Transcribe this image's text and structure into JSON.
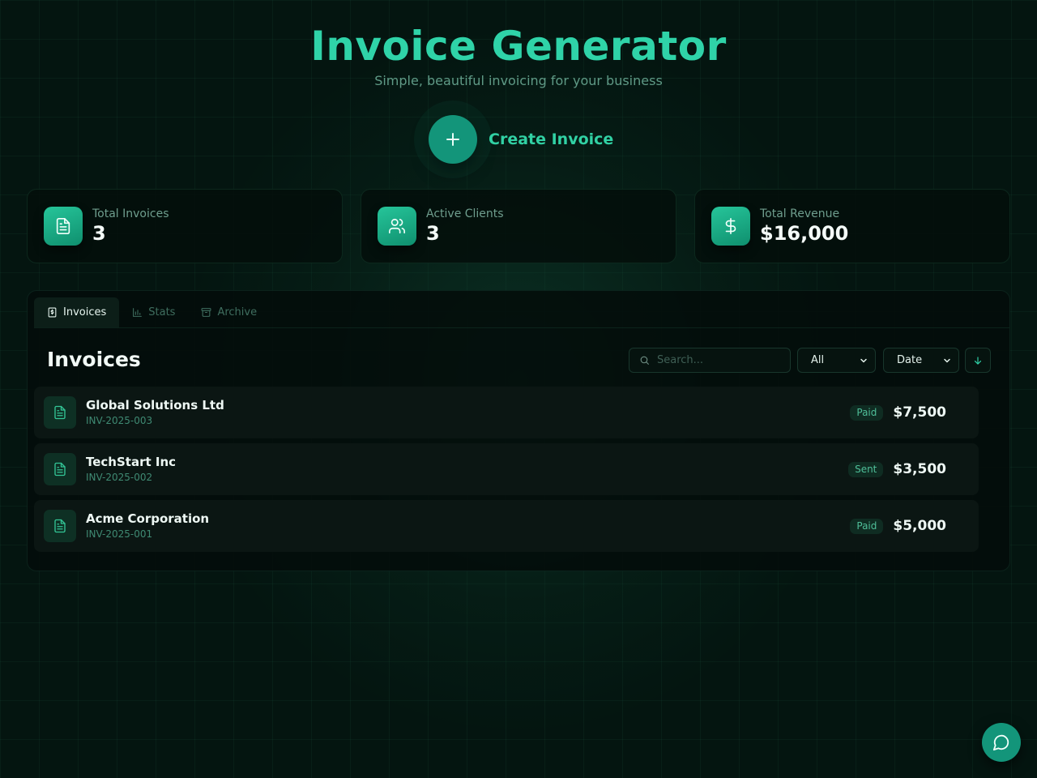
{
  "header": {
    "title": "Invoice Generator",
    "subtitle": "Simple, beautiful invoicing for your business"
  },
  "create": {
    "label": "Create Invoice",
    "icon": "plus-icon"
  },
  "stats": [
    {
      "label": "Total Invoices",
      "value": "3",
      "icon": "file-icon"
    },
    {
      "label": "Active Clients",
      "value": "3",
      "icon": "users-icon"
    },
    {
      "label": "Total Revenue",
      "value": "$16,000",
      "icon": "dollar-icon"
    }
  ],
  "tabs": [
    {
      "label": "Invoices",
      "icon": "invoice-icon",
      "active": true
    },
    {
      "label": "Stats",
      "icon": "bar-chart-icon",
      "active": false
    },
    {
      "label": "Archive",
      "icon": "archive-icon",
      "active": false
    }
  ],
  "list": {
    "title": "Invoices",
    "search_placeholder": "Search...",
    "status_filter": "All",
    "sort_field": "Date",
    "sort_direction_icon": "arrow-down-icon"
  },
  "invoices": [
    {
      "client": "Global Solutions Ltd",
      "number": "INV-2025-003",
      "status": "Paid",
      "amount": "$7,500"
    },
    {
      "client": "TechStart Inc",
      "number": "INV-2025-002",
      "status": "Sent",
      "amount": "$3,500"
    },
    {
      "client": "Acme Corporation",
      "number": "INV-2025-001",
      "status": "Paid",
      "amount": "$5,000"
    }
  ],
  "chat": {
    "icon": "chat-icon"
  },
  "colors": {
    "accent": "#2fd3a8",
    "button": "#13957a",
    "background": "#041510"
  }
}
